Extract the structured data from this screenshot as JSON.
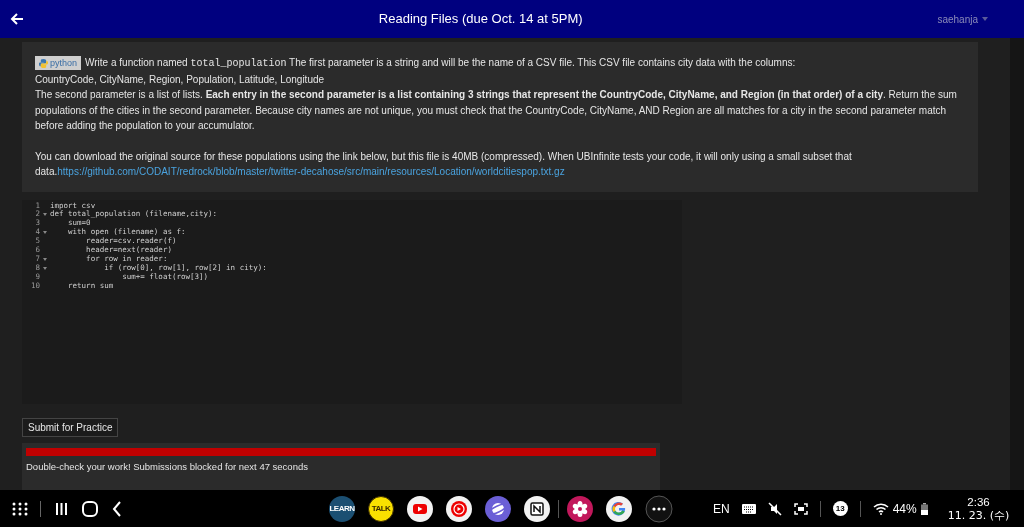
{
  "header": {
    "title": "Reading Files (due Oct. 14 at 5PM)",
    "user": "saehanja"
  },
  "problem": {
    "badge": "python",
    "lead": "Write a function named ",
    "function_name": "total_population",
    "lead_rest": " The first parameter is a string and will be the name of a CSV file. This CSV file contains city data with the columns:",
    "columns_line": "CountryCode, CityName, Region, Population, Latitude, Longitude",
    "paragraph_2": "The second parameter is a list of lists. **Each entry in the second parameter is a list containing 3 strings that represent the CountryCode, CityName, and Region (in that order) of a city**. Return the sum populations of the cities in the second parameter. Because city names are not unique, you must check that the CountryCode, CityName, AND Region are all matches for a city in the second parameter match before adding the population to your accumulator.",
    "paragraph_3": "You can download the original source for these populations using the link below, but this file is 40MB (compressed). When UBInfinite tests your code, it will only using a small subset that data.",
    "link": "https://github.com/CODAIT/redrock/blob/master/twitter-decahose/src/main/resources/Location/worldcitiespop.txt.gz"
  },
  "editor": {
    "lines": [
      {
        "number": "1",
        "text": "import csv",
        "foldable": false
      },
      {
        "number": "2",
        "text": "def total_population (filename,city):",
        "foldable": true
      },
      {
        "number": "3",
        "text": "    sum=0",
        "foldable": false
      },
      {
        "number": "4",
        "text": "    with open (filename) as f:",
        "foldable": true
      },
      {
        "number": "5",
        "text": "        reader=csv.reader(f)",
        "foldable": false
      },
      {
        "number": "6",
        "text": "        header=next(reader)",
        "foldable": false
      },
      {
        "number": "7",
        "text": "        for row in reader:",
        "foldable": true
      },
      {
        "number": "8",
        "text": "            if (row[0], row[1], row[2] in city):",
        "foldable": true
      },
      {
        "number": "9",
        "text": "                sum+= float(row[3])",
        "foldable": false
      },
      {
        "number": "10",
        "text": "    return sum",
        "foldable": false
      }
    ]
  },
  "submit_button": "Submit for Practice",
  "result": {
    "message": "Double-check your work! Submissions blocked for next 47 seconds"
  },
  "taskbar": {
    "apps": [
      {
        "kind": "learn",
        "label": "LEARN"
      },
      {
        "kind": "talk",
        "label": "TALK"
      },
      {
        "kind": "youtube"
      },
      {
        "kind": "music"
      },
      {
        "kind": "planet"
      },
      {
        "kind": "notion"
      },
      {
        "kind": "flower"
      },
      {
        "kind": "google"
      },
      {
        "kind": "more"
      }
    ],
    "language": "EN",
    "badge": "13",
    "battery": "44%",
    "time": "2:36",
    "date": "11. 23. (수)"
  }
}
